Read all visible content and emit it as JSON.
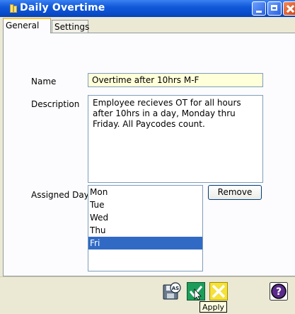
{
  "window": {
    "title": "Daily Overtime"
  },
  "tabs": [
    {
      "label": "General",
      "active": true
    },
    {
      "label": "Settings",
      "active": false
    }
  ],
  "form": {
    "name_label": "Name",
    "name_value": "Overtime after 10hrs M-F",
    "description_label": "Description",
    "description_value": "Employee recieves OT for all hours after 10hrs in a day, Monday thru Friday. All Paycodes count.",
    "assigned_day_label": "Assigned Day",
    "days": [
      "Mon",
      "Tue",
      "Wed",
      "Thu",
      "Fri"
    ],
    "selected_day": "Fri",
    "remove_label": "Remove"
  },
  "footer": {
    "buttons": [
      {
        "icon": "save-as-icon"
      },
      {
        "icon": "apply-checkmark-icon"
      },
      {
        "icon": "cancel-x-icon"
      },
      {
        "icon": "help-icon",
        "glyph": "?"
      }
    ],
    "tooltip": "Apply"
  },
  "colors": {
    "titlebar": "#0a4fd0",
    "name_field_bg": "#ffffd9",
    "selection": "#316ac5",
    "apply_green": "#1e9d5a",
    "cancel_yellow": "#f5e23a",
    "help_purple": "#5b2a8c"
  }
}
